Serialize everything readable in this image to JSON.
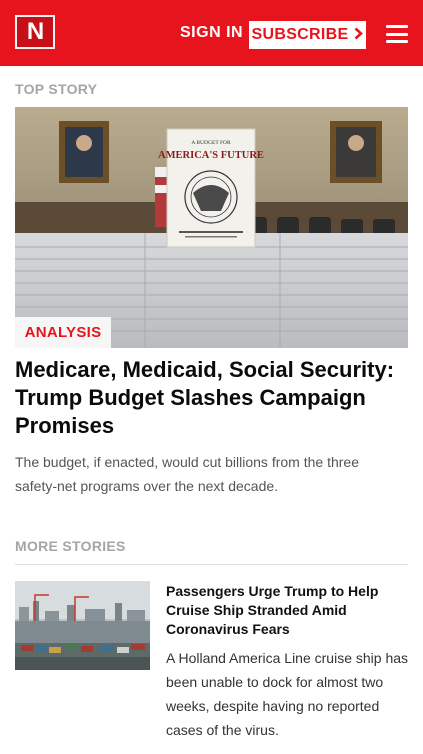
{
  "header": {
    "logo_letter": "N",
    "signin_label": "SIGN IN",
    "subscribe_label": "SUBSCRIBE",
    "brand_color": "#e8141d"
  },
  "top_story": {
    "section_label": "TOP STORY",
    "badge": "ANALYSIS",
    "headline": "Medicare, Medicaid, Social Security: Trump Budget Slashes Campaign Promises",
    "dek": "The budget, if enacted, would cut billions from the three safety-net programs over the next decade.",
    "image_book_title_small": "A BUDGET FOR",
    "image_book_title_big": "AMERICA'S FUTURE"
  },
  "more_stories": {
    "section_label": "MORE STORIES",
    "items": [
      {
        "title": "Passengers Urge Trump to Help Cruise Ship Stranded Amid Coronavirus Fears",
        "summary": "A Holland America Line cruise ship has been unable to dock for almost two weeks, despite having no reported cases of the virus."
      }
    ]
  },
  "icons": {
    "subscribe_chevron": "chevron-right-icon",
    "menu": "hamburger-menu-icon"
  }
}
